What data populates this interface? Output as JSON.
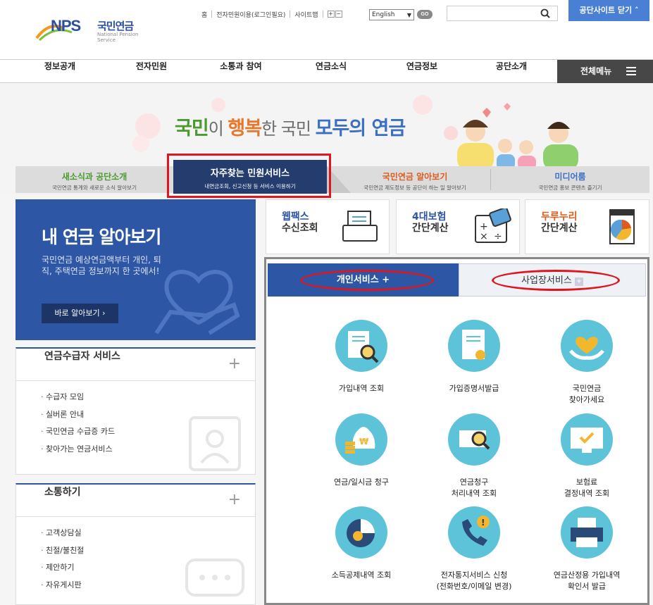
{
  "header": {
    "logo_text": "NPS",
    "logo_korean": "국민연금",
    "logo_english": "National Pension Service",
    "utils": [
      "홈",
      "전자민원이용(로그인필요)",
      "사이트맵"
    ],
    "zoom_in": "+",
    "zoom_out": "−",
    "language": "English",
    "go": "GO",
    "search_placeholder": "",
    "sites_button": "공단사이트 닫기"
  },
  "nav": {
    "items": [
      "정보공개",
      "전자민원",
      "소통과 참여",
      "연금소식",
      "연금정보",
      "공단소개"
    ],
    "all_menu": "전체메뉴"
  },
  "hero": {
    "slogan": [
      "국민",
      "이 ",
      "행복",
      "한 국민 ",
      "모두의 연금"
    ]
  },
  "tabs": [
    {
      "title": "새소식과 공단소개",
      "sub": "국민연금 통계와 새로운 소식 알아보기",
      "color": "#4a9a2e"
    },
    {
      "title": "자주찾는 민원서비스",
      "sub": "내연금조회, 신고신청 등 서비스 이용하기",
      "active": true
    },
    {
      "title": "국민연금 알아보기",
      "sub": "국민연금 제도정보 등 공단이 하는 일 알아보기",
      "color": "#e05a1a"
    },
    {
      "title": "미디어룸",
      "sub": "국민연금 홍보 콘텐츠 즐기기",
      "color": "#3a6fc4"
    }
  ],
  "my_pension": {
    "title": "내 연금 알아보기",
    "desc": "국민연금 예상연금액부터 개인, 퇴직, 주택연금 정보까지 한 곳에서!",
    "button": "바로 알아보기 ›"
  },
  "pensioner_box": {
    "title": "연금수급자 서비스",
    "items": [
      "수급자 모임",
      "실버론 안내",
      "국민연금 수급증 카드",
      "찾아가는 연금서비스"
    ]
  },
  "comm_box": {
    "title": "소통하기",
    "items": [
      "고객상담실",
      "친절/불친절",
      "제안하기",
      "자유게시판"
    ]
  },
  "quick": [
    {
      "l1": "웹팩스",
      "l2": "수신조회",
      "icon": "fax-icon"
    },
    {
      "l1": "4대보험",
      "l2": "간단계산",
      "icon": "calculator-icon"
    },
    {
      "l1": "두루누리",
      "l2": "간단계산",
      "icon": "chart-doc-icon"
    }
  ],
  "service_tabs": {
    "personal": "개인서비스",
    "business": "사업장서비스",
    "plus": "+"
  },
  "services": [
    {
      "label": [
        "가입내역 조회"
      ],
      "icon": "search-document-icon"
    },
    {
      "label": [
        "가입증명서발급"
      ],
      "icon": "certificate-icon"
    },
    {
      "label": [
        "국민연금",
        "찾아가세요"
      ],
      "icon": "heart-hands-icon"
    },
    {
      "label": [
        "연금/일시금 청구"
      ],
      "icon": "money-bag-icon"
    },
    {
      "label": [
        "연금청구",
        "처리내역 조회"
      ],
      "icon": "claim-search-icon"
    },
    {
      "label": [
        "보험료",
        "결정내역 조회"
      ],
      "icon": "monitor-check-icon"
    },
    {
      "label": [
        "소득공제내역 조회"
      ],
      "icon": "pie-chart-icon"
    },
    {
      "label": [
        "전자통지서비스 신청",
        "(전화번호/이메일 변경)"
      ],
      "icon": "phone-alert-icon"
    },
    {
      "label": [
        "연금산정용 가입내역",
        "확인서 발급"
      ],
      "icon": "printer-icon"
    }
  ]
}
